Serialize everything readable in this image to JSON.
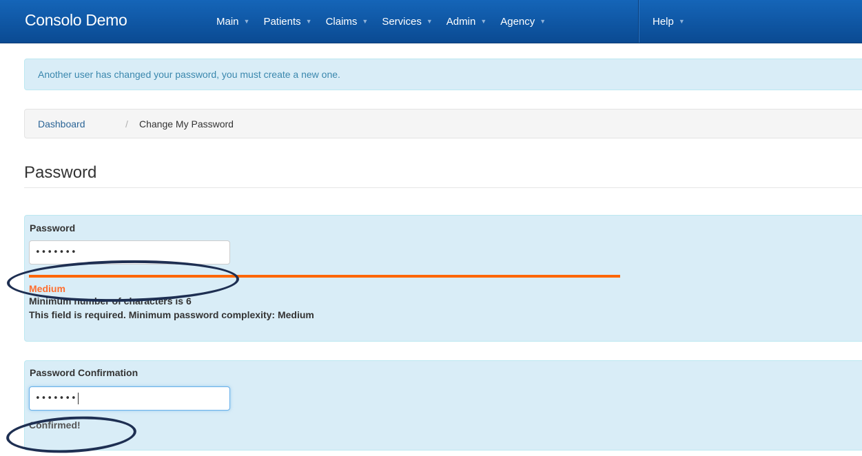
{
  "navbar": {
    "brand": "Consolo Demo",
    "menu": [
      {
        "label": "Main",
        "caret": "▼"
      },
      {
        "label": "Patients",
        "caret": "▼"
      },
      {
        "label": "Claims",
        "caret": "▼"
      },
      {
        "label": "Services",
        "caret": "▼"
      },
      {
        "label": "Admin",
        "caret": "▼"
      },
      {
        "label": "Agency",
        "caret": "▼"
      }
    ],
    "help": {
      "label": "Help",
      "caret": "▼"
    }
  },
  "alert": {
    "message": "Another user has changed your password, you must create a new one."
  },
  "breadcrumb": {
    "link": "Dashboard",
    "separator": "/",
    "current": "Change My Password"
  },
  "page": {
    "title": "Password"
  },
  "password_field": {
    "label": "Password",
    "value": "•••••••",
    "strength": "Medium",
    "strength_color": "#ff6600",
    "help_lines": [
      "Minimum number of characters is 6",
      "This field is required. Minimum password complexity: Medium"
    ]
  },
  "confirmation_field": {
    "label": "Password Confirmation",
    "value": "•••••••",
    "status": "Confirmed!"
  },
  "colors": {
    "navbar": "#0d5aa7",
    "alert_bg": "#d9edf7",
    "alert_text": "#3a87ad",
    "link": "#2a6496",
    "annotation": "#1e2f52"
  }
}
